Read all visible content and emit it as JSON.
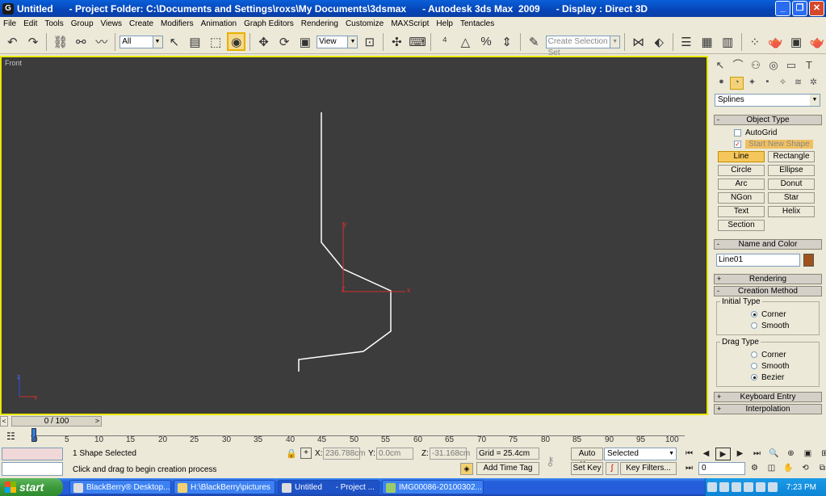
{
  "window": {
    "title": "Untitled      - Project Folder: C:\\Documents and Settings\\roxs\\My Documents\\3dsmax      - Autodesk 3ds Max  2009      - Display : Direct 3D",
    "minimize_label": "_",
    "maximize_label": "❐",
    "close_label": "✕"
  },
  "menu": [
    "File",
    "Edit",
    "Tools",
    "Group",
    "Views",
    "Create",
    "Modifiers",
    "Animation",
    "Graph Editors",
    "Rendering",
    "Customize",
    "MAXScript",
    "Help",
    "Tentacles"
  ],
  "toolbar": {
    "selection_filter": "All",
    "reference_coord": "View",
    "named_selection_placeholder": "Create Selection Set"
  },
  "viewport": {
    "label": "Front",
    "axis_x_label": "x",
    "axis_y_label": "y",
    "axis_z_label": "z",
    "gizmo_z": "z",
    "gizmo_x": "x",
    "spline_points": [
      [
        398,
        139
      ],
      [
        398,
        300
      ],
      [
        425,
        333
      ],
      [
        484,
        360
      ],
      [
        484,
        410
      ],
      [
        450,
        435
      ],
      [
        370,
        445
      ],
      [
        370,
        460
      ]
    ],
    "spline_color": "#ffffff",
    "viewport_bg": "#3c3c3c",
    "active_border": "#e8e800"
  },
  "command_panel": {
    "category": "Splines",
    "object_type_title": "Object Type",
    "autogrid_label": "AutoGrid",
    "autogrid_checked": false,
    "start_new_shape_label": "Start New Shape",
    "start_new_shape_checked": true,
    "buttons": [
      "Line",
      "Rectangle",
      "Circle",
      "Ellipse",
      "Arc",
      "Donut",
      "NGon",
      "Star",
      "Text",
      "Helix",
      "Section"
    ],
    "active_button": "Line",
    "name_color_title": "Name and Color",
    "object_name": "Line01",
    "object_color": "#a0521a",
    "rendering_title": "Rendering",
    "creation_method_title": "Creation Method",
    "initial_type_title": "Initial Type",
    "initial_type_options": [
      "Corner",
      "Smooth"
    ],
    "initial_type_selected": "Corner",
    "drag_type_title": "Drag Type",
    "drag_type_options": [
      "Corner",
      "Smooth",
      "Bezier"
    ],
    "drag_type_selected": "Bezier",
    "keyboard_entry_title": "Keyboard Entry",
    "interpolation_title": "Interpolation"
  },
  "time_slider": {
    "frame_display": "0 / 100",
    "prev_arrow": "<",
    "next_arrow": ">"
  },
  "trackbar": {
    "ticks": [
      "0",
      "5",
      "10",
      "15",
      "20",
      "25",
      "30",
      "35",
      "40",
      "45",
      "50",
      "55",
      "60",
      "65",
      "70",
      "75",
      "80",
      "85",
      "90",
      "95",
      "100"
    ]
  },
  "status": {
    "selection_count": "1 Shape Selected",
    "prompt": "Click and drag to begin creation process",
    "x_label": "X:",
    "x_value": "236.788cm",
    "y_label": "Y:",
    "y_value": "0.0cm",
    "z_label": "Z:",
    "z_value": "-31.168cm",
    "grid": "Grid = 25.4cm",
    "add_time_tag": "Add Time Tag",
    "auto_key": "Auto Key",
    "set_key": "Set Key",
    "key_mode": "Selected",
    "key_filters": "Key Filters...",
    "current_frame": "0"
  },
  "taskbar": {
    "start_label": "start",
    "items": [
      "BlackBerry® Desktop...",
      "H:\\BlackBerry\\pictures",
      "Untitled      - Project ...",
      "IMG00086-20100302..."
    ],
    "active_index": 2,
    "clock": "7:23 PM"
  }
}
